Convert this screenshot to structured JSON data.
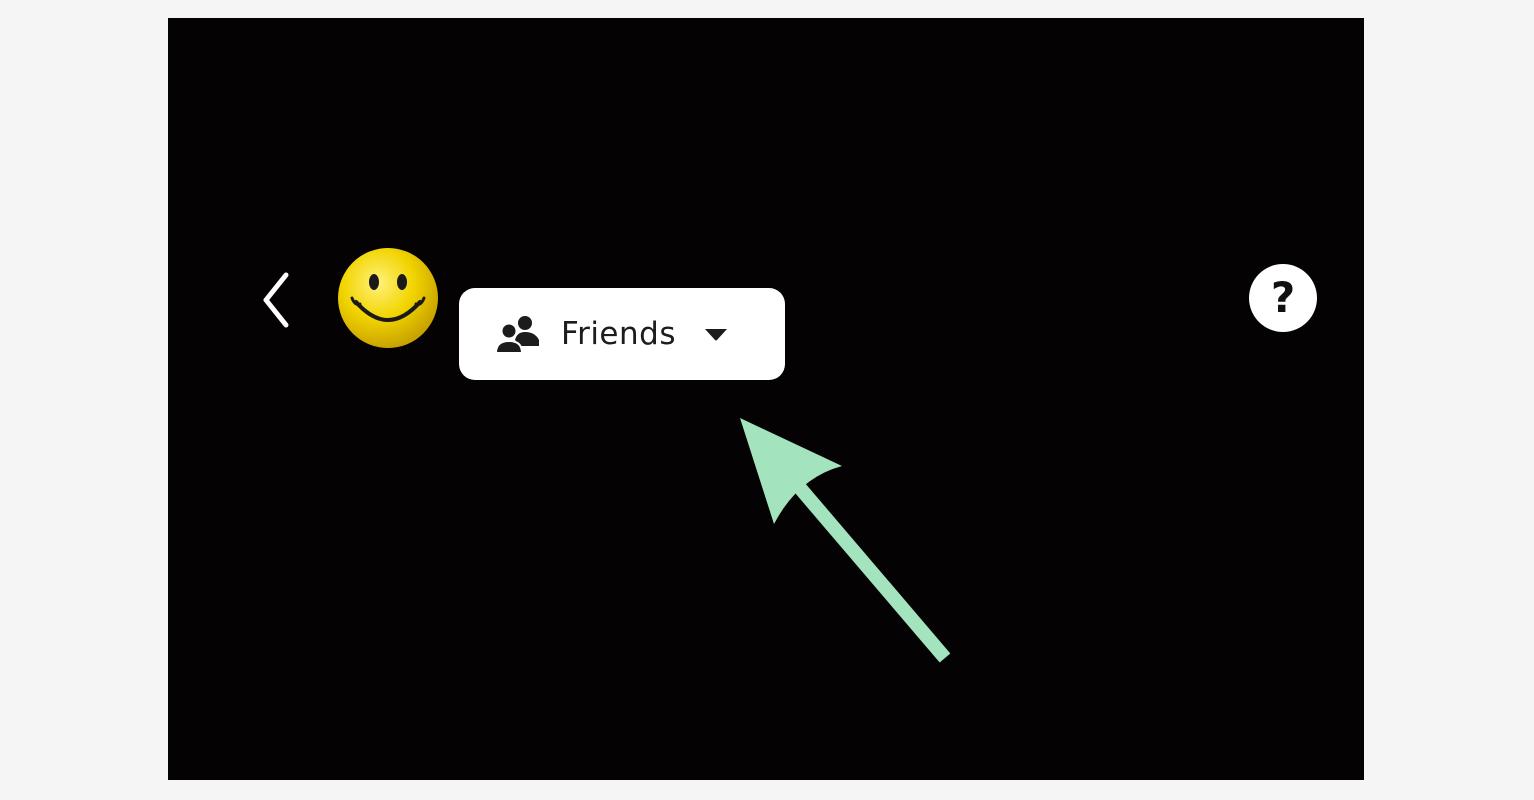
{
  "header": {
    "back_icon": "chevron-left-icon",
    "avatar_icon": "smiley-face-icon",
    "audience": {
      "label": "Friends",
      "icon": "friends-icon",
      "dropdown_icon": "caret-down-icon"
    },
    "help": {
      "glyph": "?",
      "icon": "help-icon"
    }
  },
  "annotation": {
    "type": "arrow",
    "color": "#a3e4bf"
  },
  "colors": {
    "screen_background": "#040202",
    "frame_background": "#f5f5f5",
    "button_background": "#ffffff",
    "avatar_yellow": "#f2d400"
  }
}
